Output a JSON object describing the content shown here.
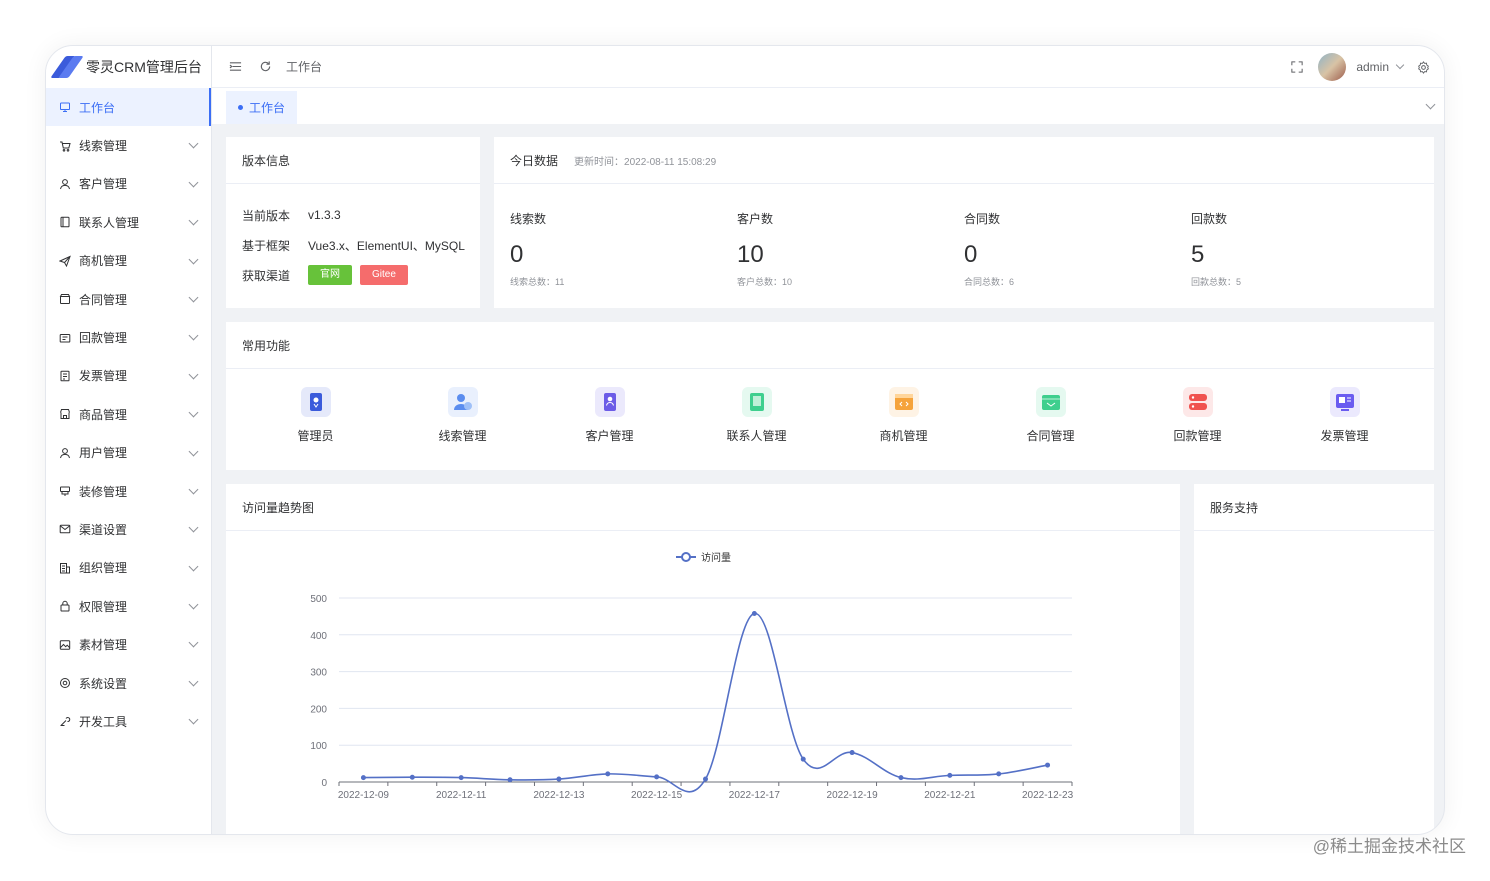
{
  "app": {
    "title": "零灵CRM管理后台"
  },
  "header": {
    "title": "工作台",
    "username": "admin"
  },
  "sidebar": {
    "items": [
      {
        "label": "工作台",
        "icon": "monitor-icon",
        "active": true
      },
      {
        "label": "线索管理",
        "icon": "cart-icon"
      },
      {
        "label": "客户管理",
        "icon": "user-icon"
      },
      {
        "label": "联系人管理",
        "icon": "notebook-icon"
      },
      {
        "label": "商机管理",
        "icon": "send-icon"
      },
      {
        "label": "合同管理",
        "icon": "box-icon"
      },
      {
        "label": "回款管理",
        "icon": "wallet-icon"
      },
      {
        "label": "发票管理",
        "icon": "ticket-icon"
      },
      {
        "label": "商品管理",
        "icon": "shop-icon"
      },
      {
        "label": "用户管理",
        "icon": "user-icon"
      },
      {
        "label": "装修管理",
        "icon": "brush-icon"
      },
      {
        "label": "渠道设置",
        "icon": "message-icon"
      },
      {
        "label": "组织管理",
        "icon": "office-icon"
      },
      {
        "label": "权限管理",
        "icon": "lock-icon"
      },
      {
        "label": "素材管理",
        "icon": "picture-icon"
      },
      {
        "label": "系统设置",
        "icon": "setting-icon"
      },
      {
        "label": "开发工具",
        "icon": "tools-icon"
      }
    ]
  },
  "tabs": [
    {
      "label": "工作台"
    }
  ],
  "version": {
    "title": "版本信息",
    "rows": [
      {
        "key": "当前版本",
        "value": "v1.3.3"
      },
      {
        "key": "基于框架",
        "value": "Vue3.x、ElementUI、MySQL"
      },
      {
        "key": "获取渠道"
      }
    ],
    "buttons": [
      {
        "label": "官网",
        "color": "#67c23a"
      },
      {
        "label": "Gitee",
        "color": "#f56c6c"
      }
    ]
  },
  "today": {
    "title": "今日数据",
    "updated": "更新时间：2022-08-11 15:08:29",
    "stats": [
      {
        "label": "线索数",
        "value": "0",
        "total": "线索总数：11"
      },
      {
        "label": "客户数",
        "value": "10",
        "total": "客户总数：10"
      },
      {
        "label": "合同数",
        "value": "0",
        "total": "合同总数：6"
      },
      {
        "label": "回款数",
        "value": "5",
        "total": "回款总数：5"
      }
    ]
  },
  "functions": {
    "title": "常用功能",
    "items": [
      {
        "label": "管理员",
        "icon": "admin-icon",
        "color": "#3b5bdb"
      },
      {
        "label": "线索管理",
        "icon": "clue-icon",
        "color": "#5b8def"
      },
      {
        "label": "客户管理",
        "icon": "customer-icon",
        "color": "#6c5ce7"
      },
      {
        "label": "联系人管理",
        "icon": "contact-icon",
        "color": "#3ecf8e"
      },
      {
        "label": "商机管理",
        "icon": "business-icon",
        "color": "#f5a33b"
      },
      {
        "label": "合同管理",
        "icon": "contract-icon",
        "color": "#3fcf8e"
      },
      {
        "label": "回款管理",
        "icon": "payment-icon",
        "color": "#f0524f"
      },
      {
        "label": "发票管理",
        "icon": "invoice-icon",
        "color": "#6a5cf0"
      }
    ]
  },
  "trend": {
    "title": "访问量趋势图"
  },
  "support": {
    "title": "服务支持"
  },
  "watermark": "@稀土掘金技术社区",
  "chart_data": {
    "type": "line",
    "title": "",
    "legend": [
      "访问量"
    ],
    "legend_position": "top-center",
    "x": [
      "2022-12-09",
      "2022-12-10",
      "2022-12-11",
      "2022-12-12",
      "2022-12-13",
      "2022-12-14",
      "2022-12-15",
      "2022-12-16",
      "2022-12-17",
      "2022-12-18",
      "2022-12-19",
      "2022-12-20",
      "2022-12-21",
      "2022-12-22",
      "2022-12-23"
    ],
    "x_tick_labels": [
      "2022-12-09",
      "2022-12-11",
      "2022-12-13",
      "2022-12-15",
      "2022-12-17",
      "2022-12-19",
      "2022-12-21",
      "2022-12-23"
    ],
    "series": [
      {
        "name": "访问量",
        "values": [
          12,
          13,
          12,
          6,
          8,
          22,
          14,
          8,
          458,
          62,
          80,
          12,
          18,
          22,
          46
        ],
        "color": "#5470c6"
      }
    ],
    "yticks": [
      0,
      100,
      200,
      300,
      400,
      500
    ],
    "ylim": [
      0,
      500
    ],
    "grid": true,
    "smooth": true
  }
}
